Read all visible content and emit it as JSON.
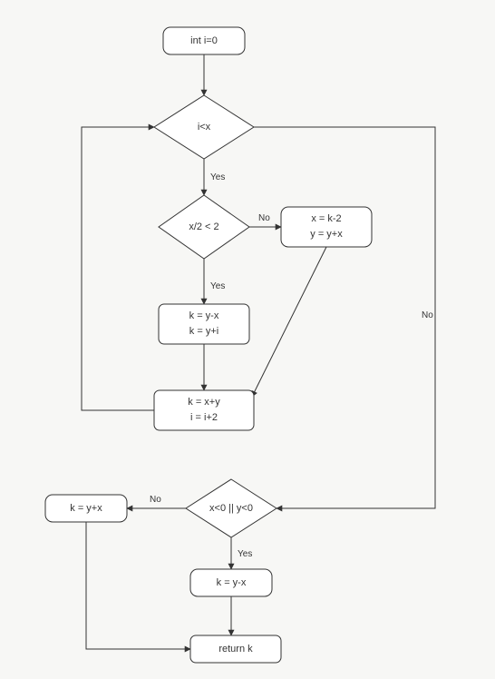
{
  "chart_data": {
    "type": "flowchart",
    "nodes": [
      {
        "id": "start",
        "kind": "terminal",
        "label": "int i=0"
      },
      {
        "id": "d1",
        "kind": "decision",
        "label": "i<x"
      },
      {
        "id": "d2",
        "kind": "decision",
        "label": "x/2 < 2"
      },
      {
        "id": "p1",
        "kind": "process",
        "label1": "x = k-2",
        "label2": "y = y+x"
      },
      {
        "id": "p2",
        "kind": "process",
        "label1": "k = y-x",
        "label2": "k = y+i"
      },
      {
        "id": "p3",
        "kind": "process",
        "label1": "k = x+y",
        "label2": "i = i+2"
      },
      {
        "id": "d3",
        "kind": "decision",
        "label": "x<0 || y<0"
      },
      {
        "id": "p4",
        "kind": "process",
        "label": "k = y+x"
      },
      {
        "id": "p5",
        "kind": "process",
        "label": "k = y-x"
      },
      {
        "id": "end",
        "kind": "terminal",
        "label": "return k"
      }
    ],
    "edges": [
      {
        "from": "start",
        "to": "d1"
      },
      {
        "from": "d1",
        "to": "d2",
        "label": "Yes"
      },
      {
        "from": "d1",
        "to": "d3",
        "label": "No"
      },
      {
        "from": "d2",
        "to": "p2",
        "label": "Yes"
      },
      {
        "from": "d2",
        "to": "p1",
        "label": "No"
      },
      {
        "from": "p1",
        "to": "p3"
      },
      {
        "from": "p2",
        "to": "p3"
      },
      {
        "from": "p3",
        "to": "d1"
      },
      {
        "from": "d3",
        "to": "p5",
        "label": "Yes"
      },
      {
        "from": "d3",
        "to": "p4",
        "label": "No"
      },
      {
        "from": "p5",
        "to": "end"
      },
      {
        "from": "p4",
        "to": "end"
      }
    ],
    "edge_labels": {
      "yes": "Yes",
      "no": "No"
    }
  }
}
